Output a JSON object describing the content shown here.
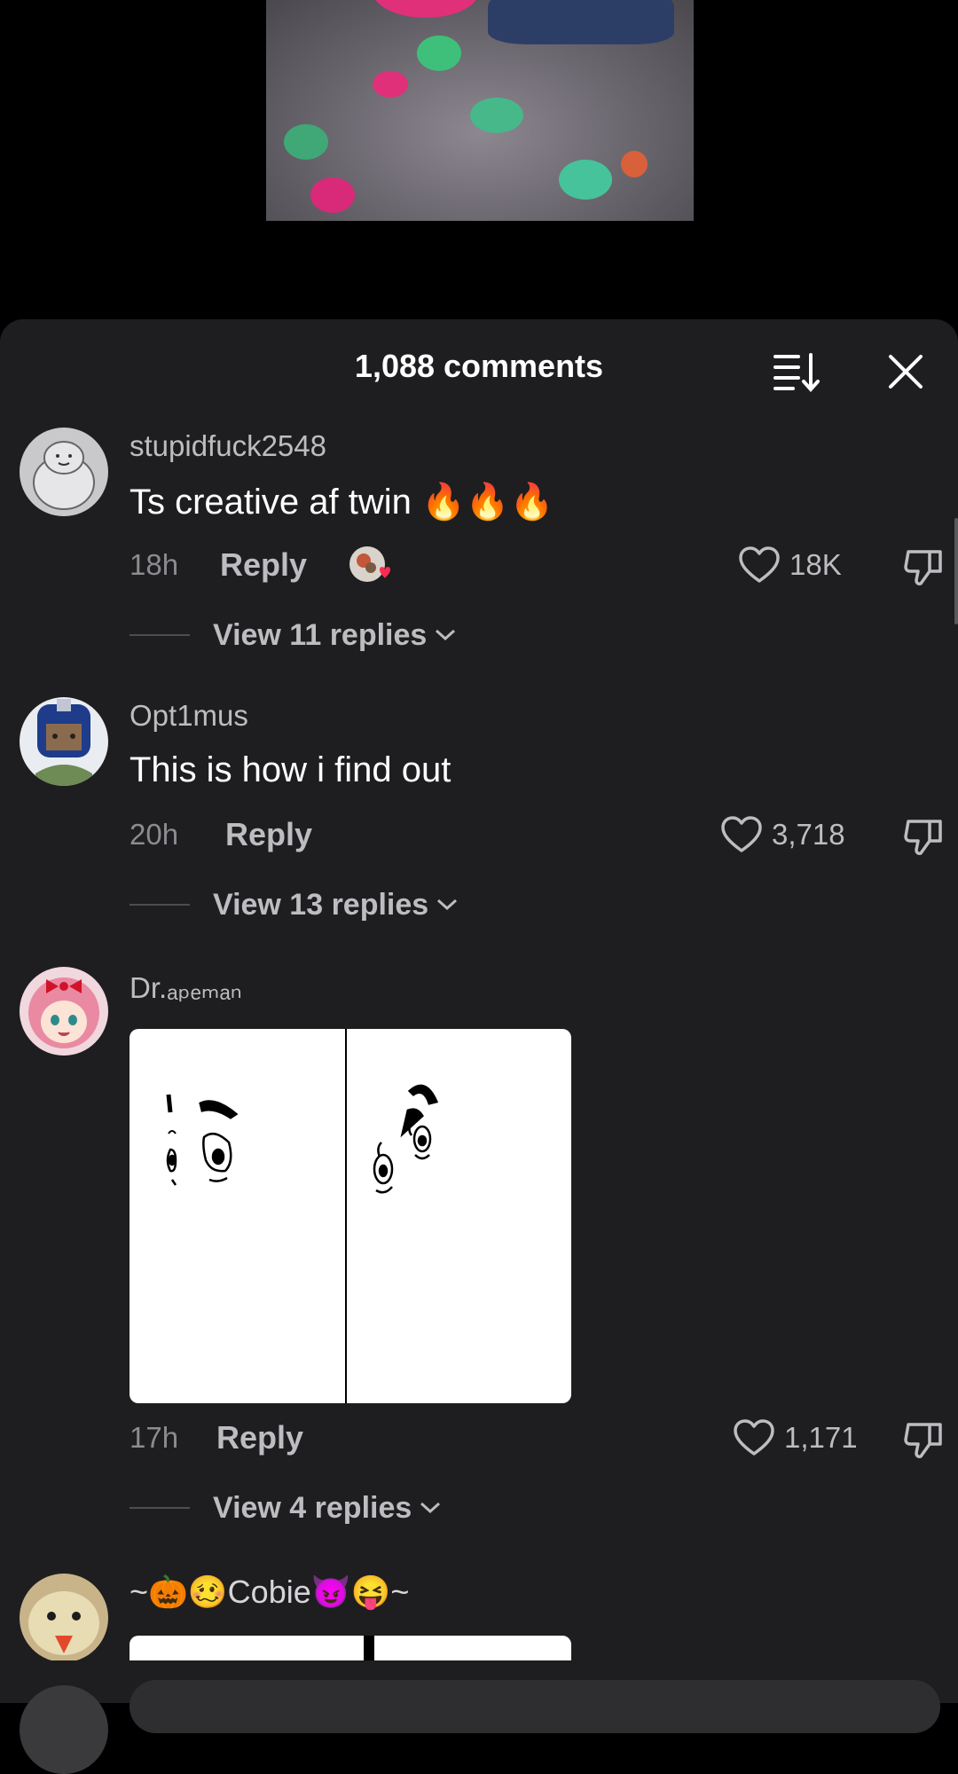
{
  "header": {
    "comment_count": "1,088 comments"
  },
  "comments": [
    {
      "username": "stupidfuck2548",
      "text": "Ts creative af twin 🔥🔥🔥",
      "time": "18h",
      "reply_label": "Reply",
      "likes": "18K",
      "view_replies": "View 11 replies"
    },
    {
      "username": "Opt1mus",
      "text": "This is how i find out",
      "time": "20h",
      "reply_label": "Reply",
      "likes": "3,718",
      "view_replies": "View 13 replies"
    },
    {
      "username": "Dr.ₐₚₑₘₐₙ",
      "time": "17h",
      "reply_label": "Reply",
      "likes": "1,171",
      "view_replies": "View 4 replies"
    },
    {
      "username": "~🎃🥴Cobie😈😝~"
    }
  ]
}
